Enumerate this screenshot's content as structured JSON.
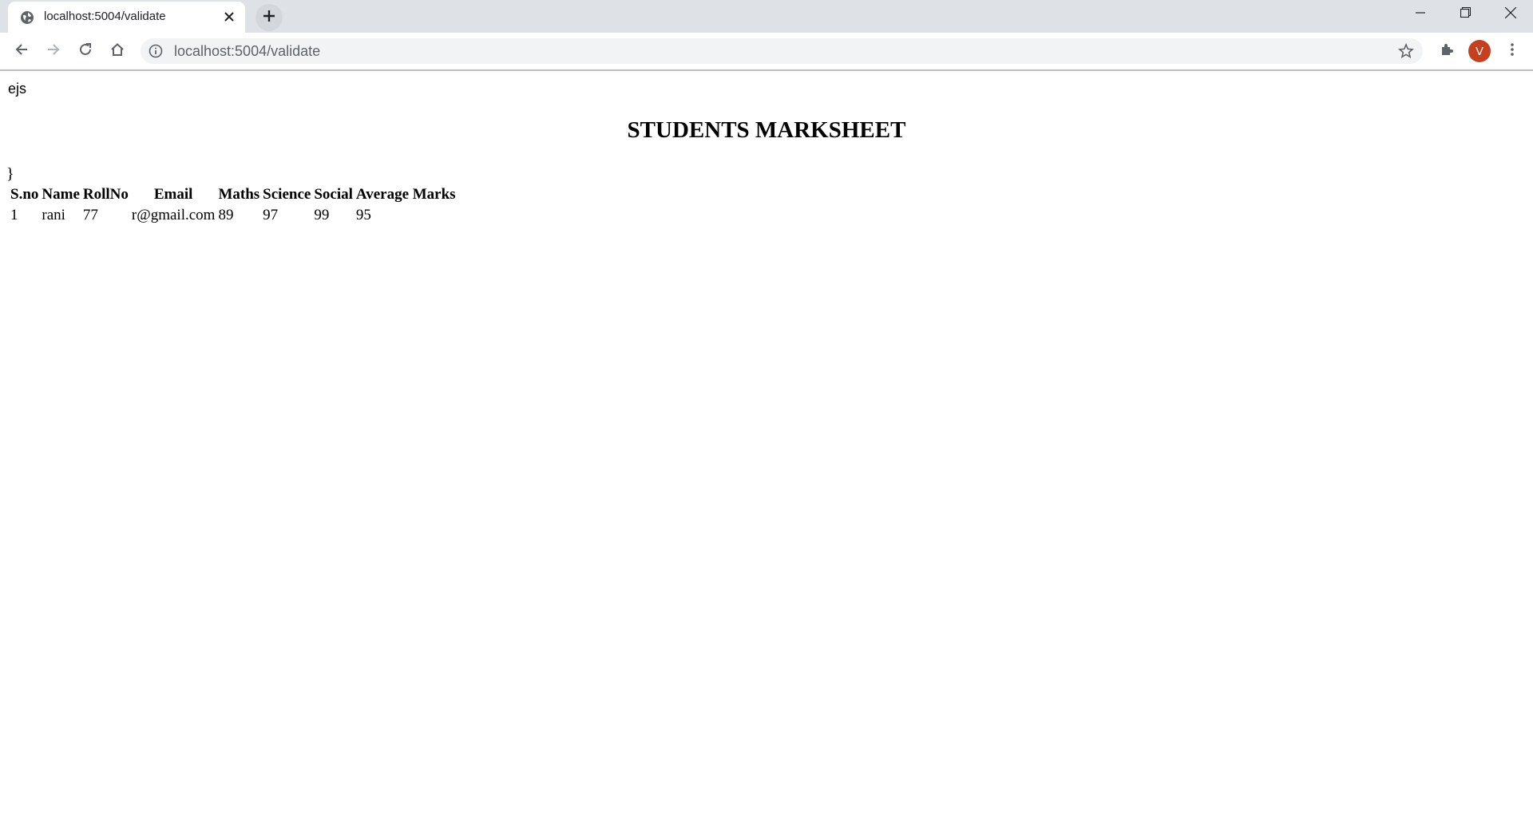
{
  "browser": {
    "tab": {
      "title": "localhost:5004/validate",
      "favicon": "globe-icon",
      "close_icon": "close-icon"
    },
    "new_tab_icon": "plus-icon",
    "window_controls": [
      "minimize-icon",
      "restore-icon",
      "close-icon"
    ],
    "nav": [
      "back-arrow-icon",
      "forward-arrow-icon",
      "reload-icon",
      "home-icon"
    ],
    "address_bar": {
      "url": "localhost:5004/validate",
      "info_icon": "info-icon",
      "bookmark_icon": "star-icon"
    },
    "extensions_icon": "puzzle-icon",
    "profile": {
      "initial": "V",
      "color": "#c5401f"
    },
    "menu_icon": "kebab-menu-icon"
  },
  "page": {
    "top_text": "ejs",
    "title": "STUDENTS MARKSHEET",
    "stray_text": "}",
    "table": {
      "headers": [
        "S.no",
        "Name",
        "RollNo",
        "Email",
        "Maths",
        "Science",
        "Social",
        "Average Marks"
      ],
      "rows": [
        [
          "1",
          "rani",
          "77",
          "r@gmail.com",
          "89",
          "97",
          "99",
          "95"
        ]
      ]
    }
  }
}
